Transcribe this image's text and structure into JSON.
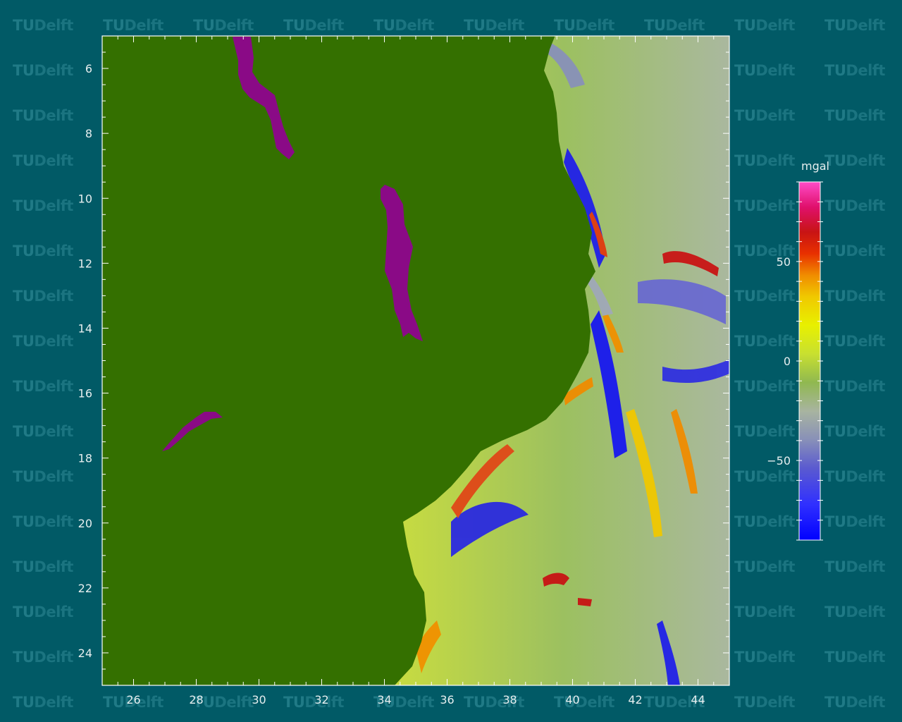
{
  "watermark": {
    "text_tu": "TU",
    "text_delft": "Delft"
  },
  "map": {
    "x_ticks": [
      "26",
      "28",
      "30",
      "32",
      "34",
      "36",
      "38",
      "40",
      "42",
      "44"
    ],
    "y_ticks": [
      "6",
      "8",
      "10",
      "12",
      "14",
      "16",
      "18",
      "20",
      "22",
      "24"
    ],
    "x_range": [
      25.0,
      45.0
    ],
    "y_range": [
      5.0,
      25.0
    ],
    "land_color": "#347000",
    "lake_color": "#8a0a86",
    "background_color": "#015a66",
    "data_units": "mgal"
  },
  "legend": {
    "title": "mgal",
    "ticks": [
      "50",
      "0",
      "−50"
    ],
    "tick_values": [
      50,
      0,
      -50
    ],
    "range": [
      -90,
      90
    ],
    "colors": [
      "#0000ff",
      "#3a3aff",
      "#6a6acc",
      "#9aa0b0",
      "#c8cccc",
      "#88b060",
      "#b8d840",
      "#e8f000",
      "#f0d000",
      "#f09000",
      "#e03000",
      "#c81010",
      "#e0106a",
      "#ff40c0"
    ]
  }
}
